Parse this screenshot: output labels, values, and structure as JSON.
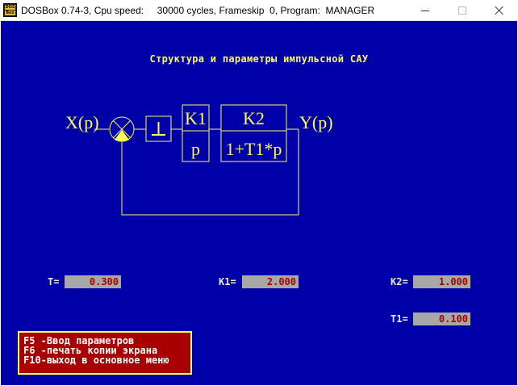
{
  "window": {
    "title": "DOSBox 0.74-3, Cpu speed:     30000 cycles, Frameskip  0, Program:  MANAGER",
    "icon_text_top": "DOS",
    "icon_text_bottom": "Box",
    "icon": "dosbox-icon",
    "controls": [
      "minimize-icon",
      "maximize-icon",
      "close-icon"
    ]
  },
  "colors": {
    "screen_bg": "#0000a8",
    "diagram_yellow": "#fcfc54",
    "field_bg": "#a8a8a8",
    "field_text": "#a80000",
    "help_bg": "#a80000"
  },
  "screen": {
    "title": "Структура и параметры импульсной САУ"
  },
  "diagram": {
    "input": "X(p)",
    "output": "Y(p)",
    "block1": {
      "num": "K1",
      "den": "p"
    },
    "block2": {
      "num": "K2",
      "den": "1+T1*p"
    },
    "sampler_icon": "sampler-icon",
    "summing_icon": "summing-junction-icon"
  },
  "params": {
    "T": {
      "label": "T=",
      "value": "0.300"
    },
    "K1": {
      "label": "K1=",
      "value": "2.000"
    },
    "K2": {
      "label": "K2=",
      "value": "1.000"
    },
    "T1": {
      "label": "T1=",
      "value": "0.100"
    }
  },
  "help": [
    "F5 -Ввод параметров",
    "F6 -печать копии экрана",
    "F10-выход в основное меню"
  ]
}
